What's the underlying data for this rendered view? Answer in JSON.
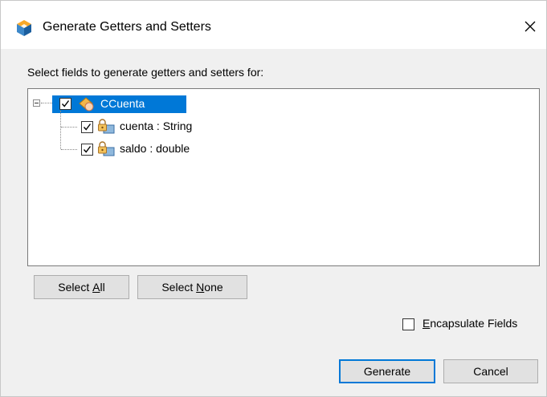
{
  "window": {
    "title": "Generate Getters and Setters",
    "close_label": "×"
  },
  "instruction": "Select fields to generate getters and setters for:",
  "tree": {
    "root": {
      "label": "CCuenta",
      "checked": true,
      "expanded": true,
      "selected": true
    },
    "children": [
      {
        "label": "cuenta : String",
        "checked": true
      },
      {
        "label": "saldo : double",
        "checked": true
      }
    ]
  },
  "buttons": {
    "select_all": {
      "prefix": "Select ",
      "mnemonic": "A",
      "suffix": "ll"
    },
    "select_none": {
      "prefix": "Select ",
      "mnemonic": "N",
      "suffix": "one"
    },
    "generate": "Generate",
    "cancel": "Cancel"
  },
  "encapsulate": {
    "mnemonic": "E",
    "suffix": "ncapsulate Fields",
    "checked": false
  },
  "colors": {
    "selection": "#0078d7",
    "dialog_bg": "#f0f0f0",
    "button_bg": "#e1e1e1"
  }
}
